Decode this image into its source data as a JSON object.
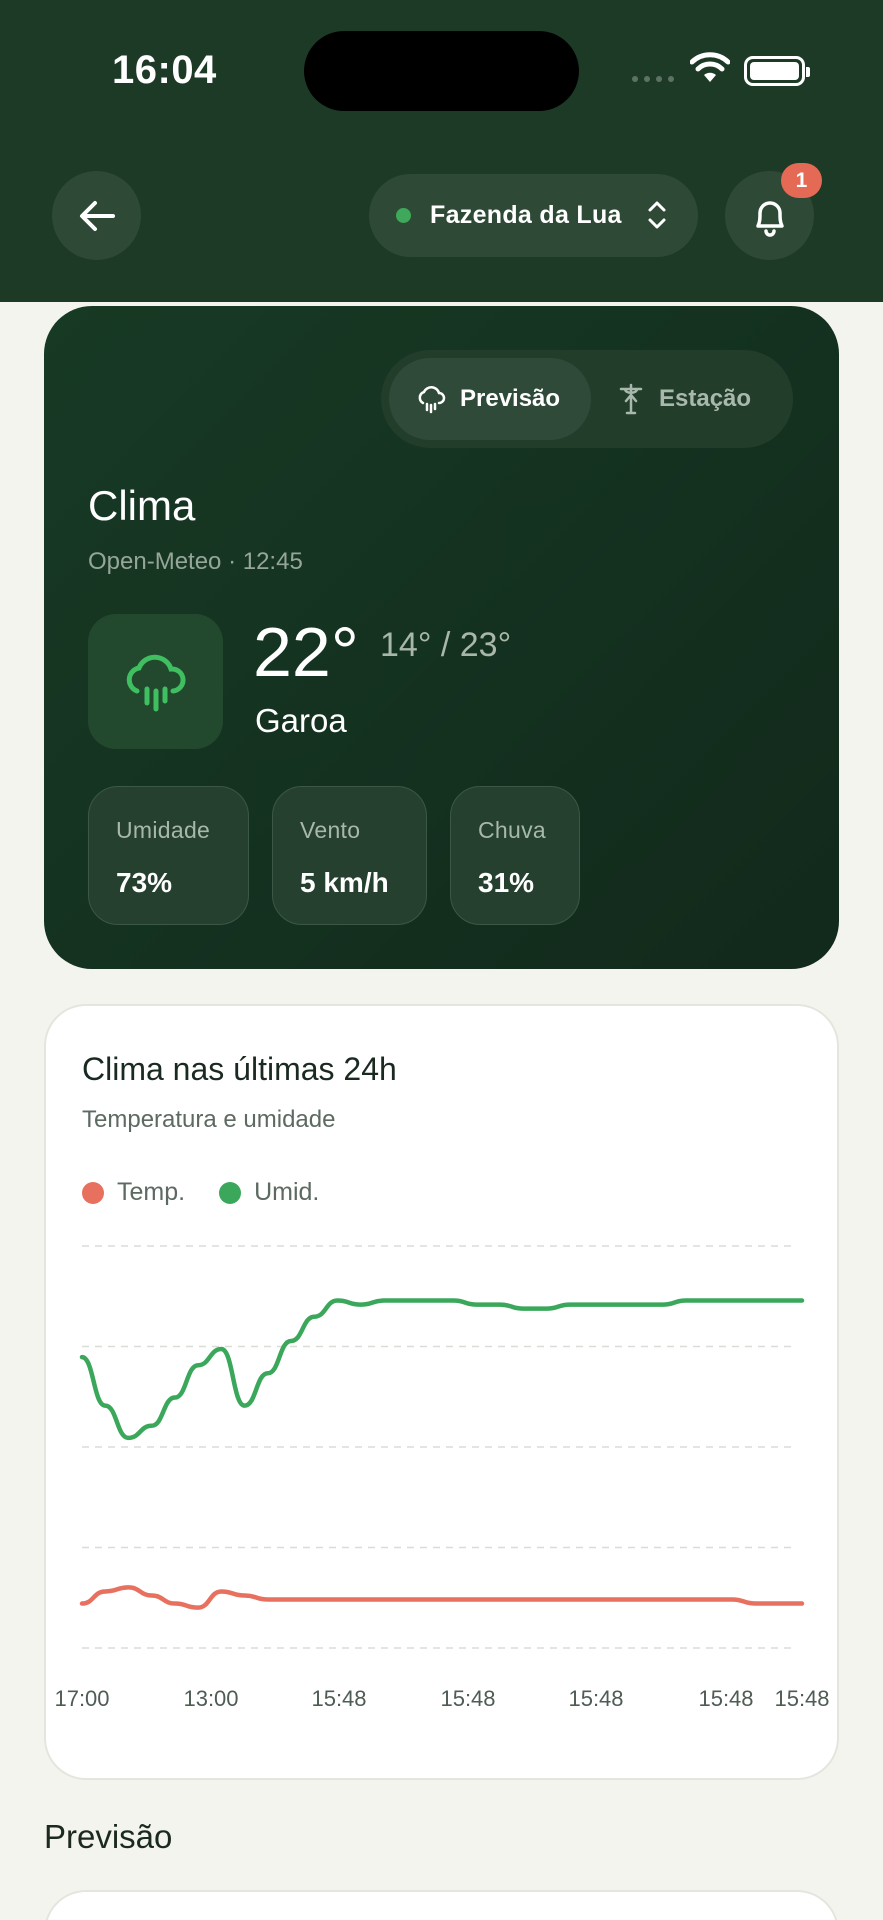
{
  "status_bar": {
    "time": "16:04"
  },
  "header": {
    "farm_name": "Fazenda da Lua",
    "notification_count": "1",
    "colors": {
      "header_bg": "#1d3a27",
      "status_dot": "#3fa85a",
      "badge": "#e46a56"
    }
  },
  "weather": {
    "tabs": [
      {
        "label": "Previsão",
        "icon": "cloud-rain-icon",
        "active": true
      },
      {
        "label": "Estação",
        "icon": "weather-station-icon",
        "active": false
      }
    ],
    "title": "Clima",
    "source": "Open-Meteo · 12:45",
    "condition_icon": "cloud-drizzle-icon",
    "temperature": "22°",
    "range": "14° / 23°",
    "condition": "Garoa",
    "metrics": [
      {
        "label": "Umidade",
        "value": "73%"
      },
      {
        "label": "Vento",
        "value": "5 km/h"
      },
      {
        "label": "Chuva",
        "value": "31%"
      }
    ]
  },
  "history_chart": {
    "title": "Clima nas últimas 24h",
    "subtitle": "Temperatura e umidade",
    "legend": [
      {
        "label": "Temp.",
        "color": "#e8705e"
      },
      {
        "label": "Umid.",
        "color": "#3ba75a"
      }
    ]
  },
  "chart_data": {
    "type": "line",
    "title": "Clima nas últimas 24h",
    "subtitle": "Temperatura e umidade",
    "x_tick_labels": [
      "17:00",
      "13:00",
      "15:48",
      "15:48",
      "15:48",
      "15:48",
      "15:48"
    ],
    "y_range": [
      0,
      100
    ],
    "grid": true,
    "legend_position": "top-left",
    "series": [
      {
        "name": "Umid.",
        "color": "#3ba75a",
        "values": [
          72,
          60,
          52,
          55,
          62,
          70,
          74,
          60,
          68,
          76,
          82,
          86,
          85,
          86,
          86,
          86,
          86,
          85,
          85,
          84,
          84,
          85,
          85,
          85,
          85,
          85,
          86,
          86,
          86,
          86,
          86,
          86
        ]
      },
      {
        "name": "Temp.",
        "color": "#e8705e",
        "values": [
          11,
          14,
          15,
          13,
          11,
          10,
          14,
          13,
          12,
          12,
          12,
          12,
          12,
          12,
          12,
          12,
          12,
          12,
          12,
          12,
          12,
          12,
          12,
          12,
          12,
          12,
          12,
          12,
          12,
          11,
          11,
          11
        ]
      }
    ]
  },
  "forecast_section": {
    "title": "Previsão"
  }
}
